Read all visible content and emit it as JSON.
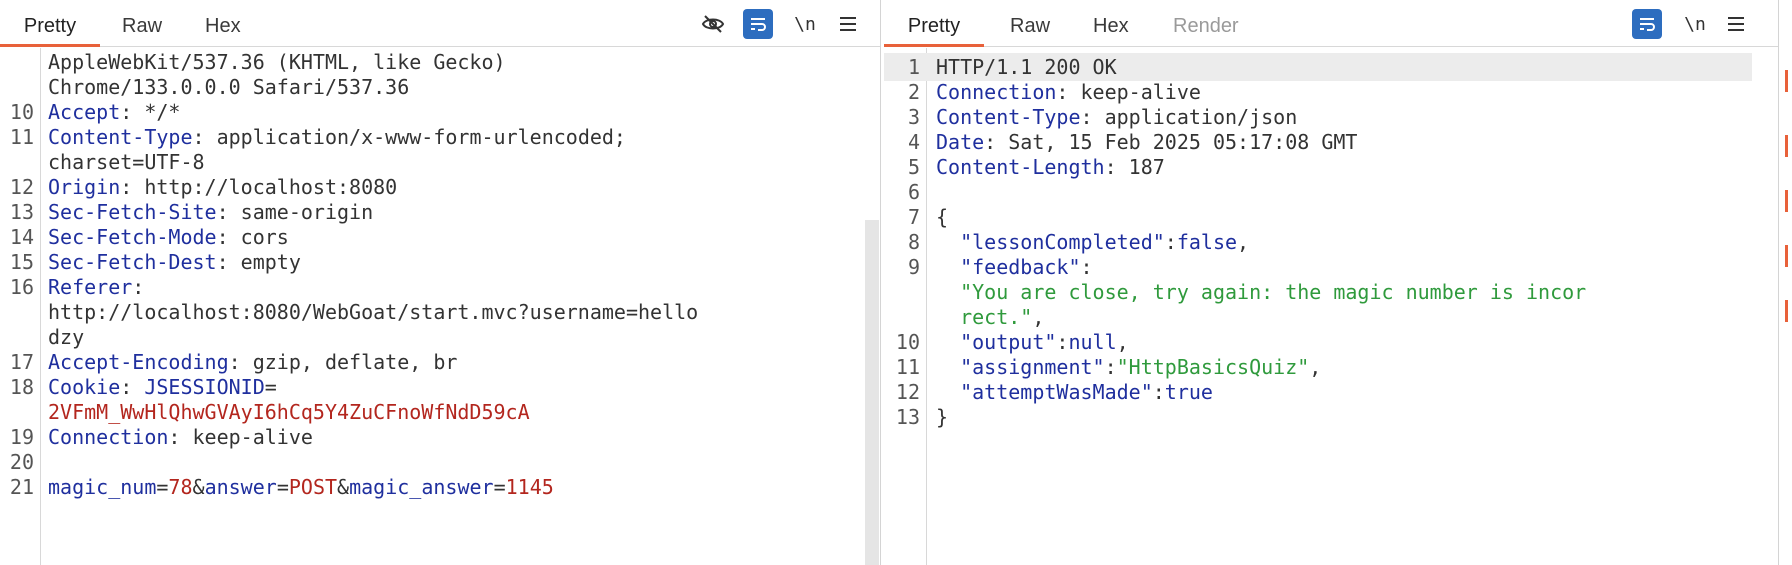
{
  "request": {
    "tabs": [
      "Pretty",
      "Raw",
      "Hex"
    ],
    "active_tab": "Pretty",
    "toolbar": {
      "hide_icon": "eye-off-icon",
      "wrap_icon": "wrap-icon",
      "newline_label": "\\n",
      "menu_icon": "menu-icon"
    },
    "lines": [
      {
        "n": "",
        "parts": [
          {
            "t": "AppleWebKit/537.36 (KHTML, like Gecko)",
            "c": "v"
          }
        ]
      },
      {
        "n": "",
        "parts": [
          {
            "t": "Chrome/133.0.0.0 Safari/537.36",
            "c": "v"
          }
        ]
      },
      {
        "n": "10",
        "parts": [
          {
            "t": "Accept",
            "c": "k"
          },
          {
            "t": ": */*",
            "c": "v"
          }
        ]
      },
      {
        "n": "11",
        "parts": [
          {
            "t": "Content-Type",
            "c": "k"
          },
          {
            "t": ": application/x-www-form-urlencoded;",
            "c": "v"
          }
        ]
      },
      {
        "n": "",
        "parts": [
          {
            "t": "charset=UTF-8",
            "c": "v"
          }
        ]
      },
      {
        "n": "12",
        "parts": [
          {
            "t": "Origin",
            "c": "k"
          },
          {
            "t": ": http://localhost:8080",
            "c": "v"
          }
        ]
      },
      {
        "n": "13",
        "parts": [
          {
            "t": "Sec-Fetch-Site",
            "c": "k"
          },
          {
            "t": ": same-origin",
            "c": "v"
          }
        ]
      },
      {
        "n": "14",
        "parts": [
          {
            "t": "Sec-Fetch-Mode",
            "c": "k"
          },
          {
            "t": ": cors",
            "c": "v"
          }
        ]
      },
      {
        "n": "15",
        "parts": [
          {
            "t": "Sec-Fetch-Dest",
            "c": "k"
          },
          {
            "t": ": empty",
            "c": "v"
          }
        ]
      },
      {
        "n": "16",
        "parts": [
          {
            "t": "Referer",
            "c": "k"
          },
          {
            "t": ":",
            "c": "v"
          }
        ]
      },
      {
        "n": "",
        "parts": [
          {
            "t": "http://localhost:8080/WebGoat/start.mvc?username=hello",
            "c": "v"
          }
        ]
      },
      {
        "n": "",
        "parts": [
          {
            "t": "dzy",
            "c": "v"
          }
        ]
      },
      {
        "n": "17",
        "parts": [
          {
            "t": "Accept-Encoding",
            "c": "k"
          },
          {
            "t": ": gzip, deflate, br",
            "c": "v"
          }
        ]
      },
      {
        "n": "18",
        "parts": [
          {
            "t": "Cookie",
            "c": "k"
          },
          {
            "t": ": ",
            "c": "v"
          },
          {
            "t": "JSESSIONID",
            "c": "k"
          },
          {
            "t": "=",
            "c": "v"
          }
        ]
      },
      {
        "n": "",
        "parts": [
          {
            "t": "2VFmM_WwHlQhwGVAyI6hCq5Y4ZuCFnoWfNdD59cA",
            "c": "r"
          }
        ]
      },
      {
        "n": "19",
        "parts": [
          {
            "t": "Connection",
            "c": "k"
          },
          {
            "t": ": keep-alive",
            "c": "v"
          }
        ]
      },
      {
        "n": "20",
        "parts": []
      },
      {
        "n": "21",
        "parts": [
          {
            "t": "magic_num",
            "c": "k"
          },
          {
            "t": "=",
            "c": "v"
          },
          {
            "t": "78",
            "c": "r"
          },
          {
            "t": "&",
            "c": "v"
          },
          {
            "t": "answer",
            "c": "k"
          },
          {
            "t": "=",
            "c": "v"
          },
          {
            "t": "POST",
            "c": "r"
          },
          {
            "t": "&",
            "c": "v"
          },
          {
            "t": "magic_answer",
            "c": "k"
          },
          {
            "t": "=",
            "c": "v"
          },
          {
            "t": "1145",
            "c": "r"
          }
        ]
      }
    ]
  },
  "response": {
    "tabs": [
      "Pretty",
      "Raw",
      "Hex",
      "Render"
    ],
    "active_tab": "Pretty",
    "toolbar": {
      "wrap_icon": "wrap-icon",
      "newline_label": "\\n",
      "menu_icon": "menu-icon"
    },
    "lines": [
      {
        "n": "1",
        "parts": [
          {
            "t": "HTTP/1.1 200 OK",
            "c": "v"
          }
        ]
      },
      {
        "n": "2",
        "parts": [
          {
            "t": "Connection",
            "c": "k"
          },
          {
            "t": ": keep-alive",
            "c": "v"
          }
        ]
      },
      {
        "n": "3",
        "parts": [
          {
            "t": "Content-Type",
            "c": "k"
          },
          {
            "t": ": application/json",
            "c": "v"
          }
        ]
      },
      {
        "n": "4",
        "parts": [
          {
            "t": "Date",
            "c": "k"
          },
          {
            "t": ": Sat, 15 Feb 2025 05:17:08 GMT",
            "c": "v"
          }
        ]
      },
      {
        "n": "5",
        "parts": [
          {
            "t": "Content-Length",
            "c": "k"
          },
          {
            "t": ": 187",
            "c": "v"
          }
        ]
      },
      {
        "n": "6",
        "parts": []
      },
      {
        "n": "7",
        "parts": [
          {
            "t": "{",
            "c": "v"
          }
        ]
      },
      {
        "n": "8",
        "parts": [
          {
            "t": "  \"lessonCompleted\"",
            "c": "k"
          },
          {
            "t": ":",
            "c": "v"
          },
          {
            "t": "false",
            "c": "k"
          },
          {
            "t": ",",
            "c": "v"
          }
        ]
      },
      {
        "n": "9",
        "parts": [
          {
            "t": "  \"feedback\"",
            "c": "k"
          },
          {
            "t": ":",
            "c": "v"
          }
        ]
      },
      {
        "n": "",
        "parts": [
          {
            "t": "  \"You are close, try again: the magic number is incor",
            "c": "s"
          }
        ]
      },
      {
        "n": "",
        "parts": [
          {
            "t": "  rect.\"",
            "c": "s"
          },
          {
            "t": ",",
            "c": "v"
          }
        ]
      },
      {
        "n": "10",
        "parts": [
          {
            "t": "  \"output\"",
            "c": "k"
          },
          {
            "t": ":",
            "c": "v"
          },
          {
            "t": "null",
            "c": "k"
          },
          {
            "t": ",",
            "c": "v"
          }
        ]
      },
      {
        "n": "11",
        "parts": [
          {
            "t": "  \"assignment\"",
            "c": "k"
          },
          {
            "t": ":",
            "c": "v"
          },
          {
            "t": "\"HttpBasicsQuiz\"",
            "c": "s"
          },
          {
            "t": ",",
            "c": "v"
          }
        ]
      },
      {
        "n": "12",
        "parts": [
          {
            "t": "  \"attemptWasMade\"",
            "c": "k"
          },
          {
            "t": ":",
            "c": "v"
          },
          {
            "t": "true",
            "c": "k"
          }
        ]
      },
      {
        "n": "13",
        "parts": [
          {
            "t": "}",
            "c": "v"
          }
        ]
      }
    ]
  }
}
